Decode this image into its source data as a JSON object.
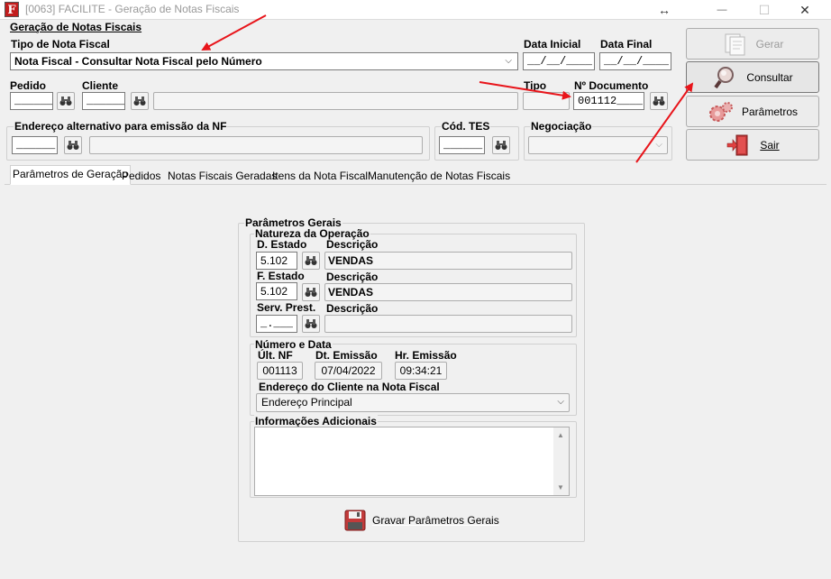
{
  "window": {
    "title": "[0063] FACILITE - Geração de Notas Fiscais",
    "app_icon_letter": "F",
    "resize_glyph": "↔",
    "minimize_glyph": "—",
    "maximize_glyph": "☐",
    "close_glyph": "✕"
  },
  "header": {
    "group_title": "Geração de Notas Fiscais",
    "tipo_label": "Tipo de Nota Fiscal",
    "tipo_value": "Nota Fiscal - Consultar Nota Fiscal pelo Número",
    "data_inicial_label": "Data Inicial",
    "data_inicial_value": "__/__/____",
    "data_final_label": "Data Final",
    "data_final_value": "__/__/____",
    "pedido_label": "Pedido",
    "pedido_value": "______",
    "cliente_label": "Cliente",
    "cliente_value": "______",
    "cliente_nome_value": "",
    "tipo_doc_label": "Tipo",
    "ndoc_label": "Nº Documento",
    "ndoc_value": "001112____",
    "endereco_label": "Endereço alternativo para emissão da NF",
    "endereco_code_value": "______",
    "endereco_desc_value": "",
    "cod_tes_label": "Cód. TES",
    "cod_tes_value": "______",
    "negociacao_label": "Negociação",
    "negociacao_value": ""
  },
  "buttons": {
    "gerar": "Gerar",
    "consultar": "Consultar",
    "parametros": "Parâmetros",
    "sair": "Sair"
  },
  "tabs": [
    {
      "label": "Parâmetros de Geração",
      "active": true
    },
    {
      "label": "Pedidos"
    },
    {
      "label": "Notas Fiscais Geradas"
    },
    {
      "label": "Itens da Nota Fiscal"
    },
    {
      "label": "Manutenção de Notas Fiscais"
    }
  ],
  "params": {
    "title": "Parâmetros Gerais",
    "natureza_title": "Natureza da Operação",
    "d_estado_label": "D. Estado",
    "d_estado_value": "5.102",
    "desc_label": "Descrição",
    "d_estado_desc": "VENDAS",
    "f_estado_label": "F. Estado",
    "f_estado_value": "5.102",
    "f_estado_desc": "VENDAS",
    "serv_label": "Serv. Prest.",
    "serv_value": "_.___",
    "serv_desc": "",
    "numero_title": "Número e Data",
    "ult_nf_label": "Últ. NF",
    "ult_nf_value": "001113",
    "dt_emissao_label": "Dt. Emissão",
    "dt_emissao_value": "07/04/2022",
    "hr_emissao_label": "Hr. Emissão",
    "hr_emissao_value": "09:34:21",
    "endereco_cliente_label": "Endereço do Cliente na Nota Fiscal",
    "endereco_cliente_value": "Endereço Principal",
    "info_title": "Informações Adicionais",
    "info_value": "",
    "gravar_label": "Gravar Parâmetros Gerais"
  },
  "colors": {
    "annotation_arrow": "#e8141a",
    "title_text": "#999999",
    "accent_red": "#c21d1d"
  }
}
